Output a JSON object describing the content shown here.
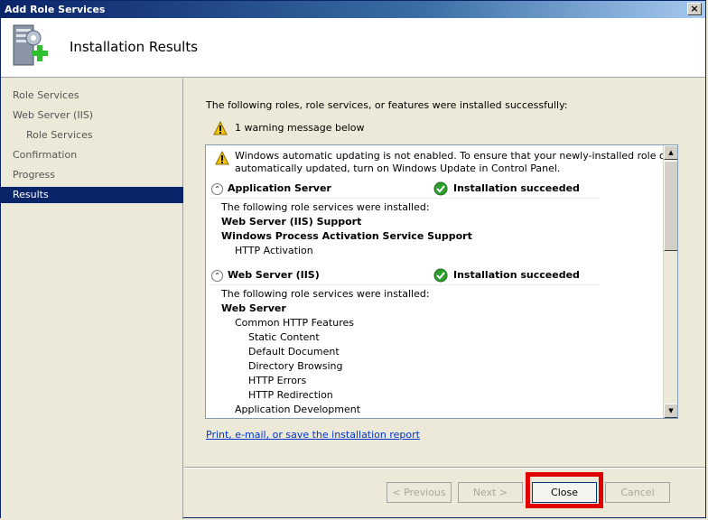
{
  "window": {
    "title": "Add Role Services",
    "close_glyph": "×"
  },
  "header": {
    "title": "Installation Results",
    "icon": "server-add-icon"
  },
  "nav": {
    "items": [
      {
        "label": "Role Services",
        "indent": 0,
        "active": false
      },
      {
        "label": "Web Server (IIS)",
        "indent": 0,
        "active": false
      },
      {
        "label": "Role Services",
        "indent": 1,
        "active": false
      },
      {
        "label": "Confirmation",
        "indent": 0,
        "active": false
      },
      {
        "label": "Progress",
        "indent": 0,
        "active": false
      },
      {
        "label": "Results",
        "indent": 0,
        "active": true
      }
    ]
  },
  "main": {
    "intro": "The following roles, role services, or features were installed successfully:",
    "warning_summary": "1 warning message below",
    "results": {
      "warning_text_1": "Windows automatic updating is not enabled. To ensure that your newly-installed role or feature is",
      "warning_text_2": "automatically updated, turn on Windows Update in Control Panel.",
      "sections": [
        {
          "name": "Application Server",
          "status": "Installation succeeded",
          "lines": [
            {
              "text": "The following role services were installed:",
              "bold": false,
              "indent": 0
            },
            {
              "text": "Web Server (IIS) Support",
              "bold": true,
              "indent": 0
            },
            {
              "text": "Windows Process Activation Service Support",
              "bold": true,
              "indent": 0
            },
            {
              "text": "HTTP Activation",
              "bold": false,
              "indent": 1
            }
          ]
        },
        {
          "name": "Web Server (IIS)",
          "status": "Installation succeeded",
          "lines": [
            {
              "text": "The following role services were installed:",
              "bold": false,
              "indent": 0
            },
            {
              "text": "Web Server",
              "bold": true,
              "indent": 0
            },
            {
              "text": "Common HTTP Features",
              "bold": false,
              "indent": 1
            },
            {
              "text": "Static Content",
              "bold": false,
              "indent": 2
            },
            {
              "text": "Default Document",
              "bold": false,
              "indent": 2
            },
            {
              "text": "Directory Browsing",
              "bold": false,
              "indent": 2
            },
            {
              "text": "HTTP Errors",
              "bold": false,
              "indent": 2
            },
            {
              "text": "HTTP Redirection",
              "bold": false,
              "indent": 2
            },
            {
              "text": "Application Development",
              "bold": false,
              "indent": 1
            }
          ]
        }
      ]
    },
    "report_link": "Print, e-mail, or save the installation report"
  },
  "buttons": {
    "previous": "< Previous",
    "next": "Next >",
    "close": "Close",
    "cancel": "Cancel"
  },
  "colors": {
    "titlebar": "#0a246a",
    "selection": "#0a246a",
    "link": "#0033cc",
    "highlight": "#e00000",
    "success": "#2e9e2e"
  }
}
